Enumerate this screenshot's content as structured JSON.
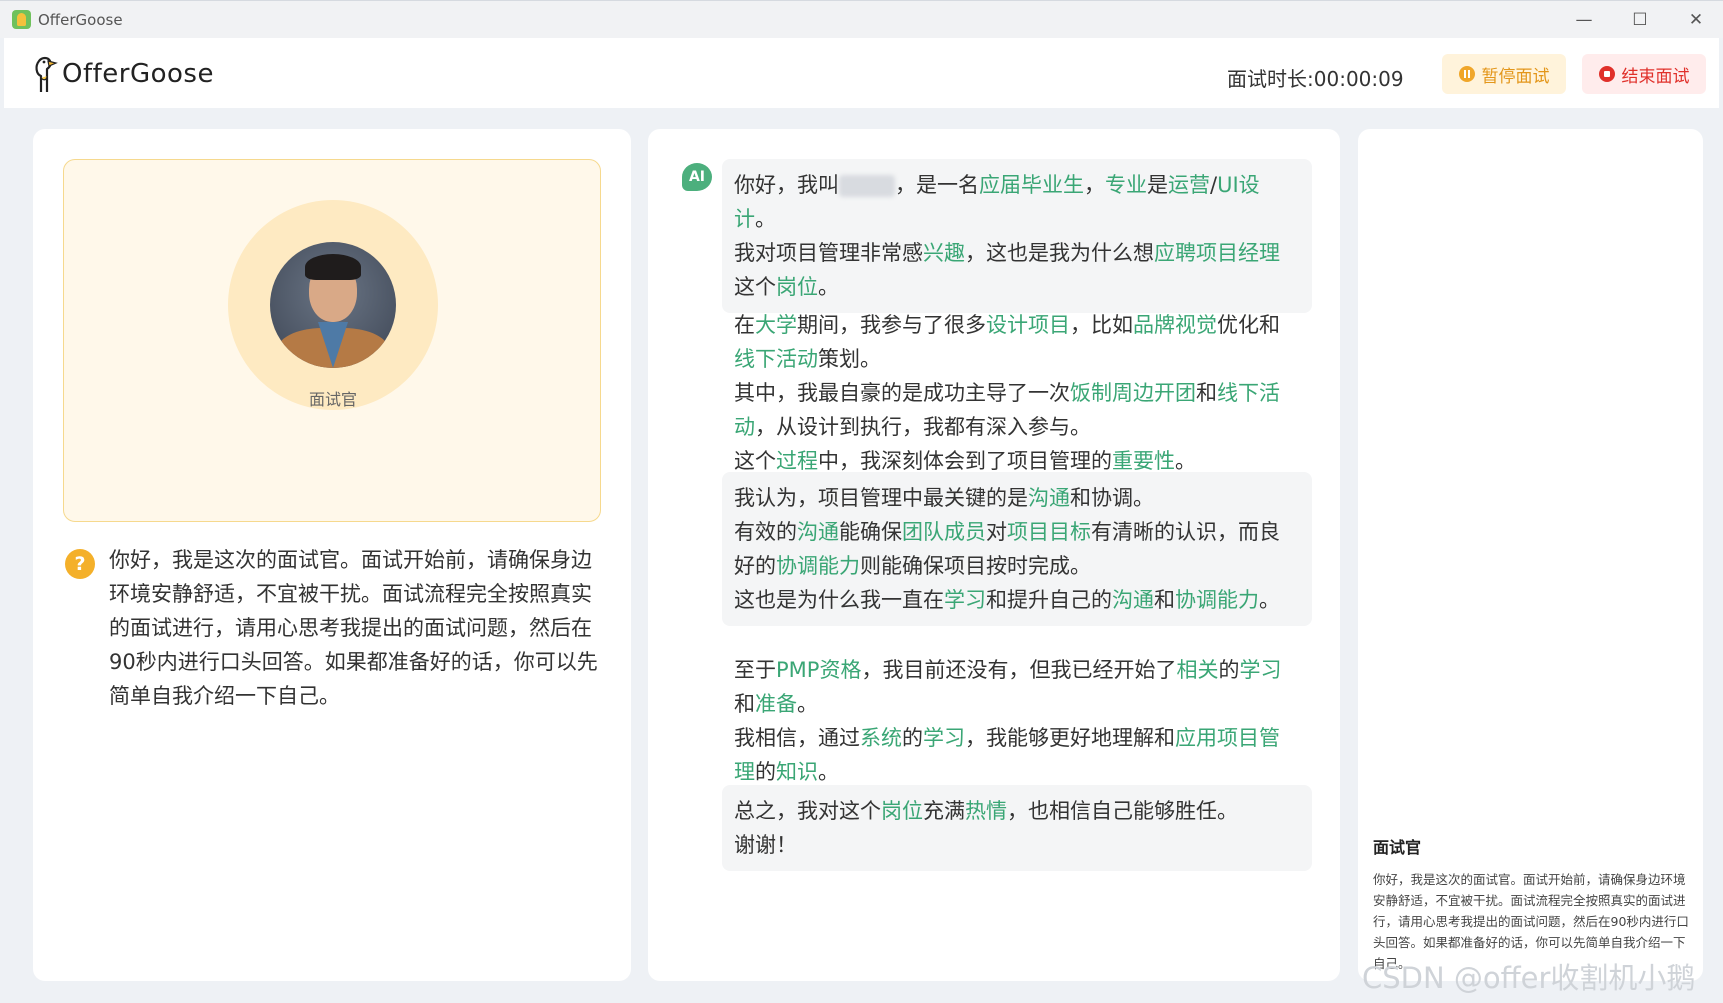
{
  "window": {
    "title": "OfferGoose",
    "controls": [
      "—",
      "☐",
      "✕"
    ]
  },
  "header": {
    "logo_text": "OfferGoose",
    "timer_label": "面试时长:",
    "timer_value": "00:00:09",
    "pause_label": "暂停面试",
    "end_label": "结束面试"
  },
  "interviewer_card": {
    "label": "面试官",
    "question": "你好，我是这次的面试官。面试开始前，请确保身边环境安静舒适，不宜被干扰。面试流程完全按照真实的面试进行，请用心思考我提出的面试问题，然后在90秒内进行口头回答。如果都准备好的话，你可以先简单自我介绍一下自己。"
  },
  "chat": {
    "badge": "AI",
    "messages": [
      {
        "segments": [
          {
            "t": "你好，我叫"
          },
          {
            "t": "",
            "blur": true
          },
          {
            "t": "，是一名"
          },
          {
            "t": "应届毕业生",
            "h": true
          },
          {
            "t": "，"
          },
          {
            "t": "专业",
            "h": true
          },
          {
            "t": "是"
          },
          {
            "t": "运营",
            "h": true
          },
          {
            "t": "/"
          },
          {
            "t": "UI设计",
            "h": true
          },
          {
            "t": "。"
          },
          {
            "br": true
          },
          {
            "t": "我对项目管理非常感"
          },
          {
            "t": "兴趣",
            "h": true
          },
          {
            "t": "，这也是我为什么想"
          },
          {
            "t": "应聘项目经理",
            "h": true
          },
          {
            "t": "这个"
          },
          {
            "t": "岗位",
            "h": true
          },
          {
            "t": "。"
          }
        ]
      },
      {
        "segments": [
          {
            "t": "在"
          },
          {
            "t": "大学",
            "h": true
          },
          {
            "t": "期间，我参与了很多"
          },
          {
            "t": "设计项目",
            "h": true
          },
          {
            "t": "，比如"
          },
          {
            "t": "品牌视觉",
            "h": true
          },
          {
            "t": "优化和"
          },
          {
            "t": "线下活动",
            "h": true
          },
          {
            "t": "策划。"
          },
          {
            "br": true
          },
          {
            "t": "其中，我最自豪的是成功主导了一次"
          },
          {
            "t": "饭制周边开团",
            "h": true
          },
          {
            "t": "和"
          },
          {
            "t": "线下活动",
            "h": true
          },
          {
            "t": "，从设计到执行，我都有深入参与。"
          },
          {
            "br": true
          },
          {
            "t": "这个"
          },
          {
            "t": "过程",
            "h": true
          },
          {
            "t": "中，我深刻体会到了项目管理的"
          },
          {
            "t": "重要性",
            "h": true
          },
          {
            "t": "。"
          }
        ]
      },
      {
        "segments": [
          {
            "t": "我认为，项目管理中最关键的是"
          },
          {
            "t": "沟通",
            "h": true
          },
          {
            "t": "和协调。"
          },
          {
            "br": true
          },
          {
            "t": "有效的"
          },
          {
            "t": "沟通",
            "h": true
          },
          {
            "t": "能确保"
          },
          {
            "t": "团队成员",
            "h": true
          },
          {
            "t": "对"
          },
          {
            "t": "项目目标",
            "h": true
          },
          {
            "t": "有清晰的认识，而良好的"
          },
          {
            "t": "协调能力",
            "h": true
          },
          {
            "t": "则能确保项目按时完成。"
          },
          {
            "br": true
          },
          {
            "t": "这也是为什么我一直在"
          },
          {
            "t": "学习",
            "h": true
          },
          {
            "t": "和提升自己的"
          },
          {
            "t": "沟通",
            "h": true
          },
          {
            "t": "和"
          },
          {
            "t": "协调能力",
            "h": true
          },
          {
            "t": "。"
          }
        ]
      },
      {
        "segments": [
          {
            "t": "至于"
          },
          {
            "t": "PMP资格",
            "h": true
          },
          {
            "t": "，我目前还没有，但我已经开始了"
          },
          {
            "t": "相关",
            "h": true
          },
          {
            "t": "的"
          },
          {
            "t": "学习",
            "h": true
          },
          {
            "t": "和"
          },
          {
            "t": "准备",
            "h": true
          },
          {
            "t": "。"
          },
          {
            "br": true
          },
          {
            "t": "我相信，通过"
          },
          {
            "t": "系统",
            "h": true
          },
          {
            "t": "的"
          },
          {
            "t": "学习",
            "h": true
          },
          {
            "t": "，我能够更好地理解和"
          },
          {
            "t": "应用项目管理",
            "h": true
          },
          {
            "t": "的"
          },
          {
            "t": "知识",
            "h": true
          },
          {
            "t": "。"
          }
        ]
      },
      {
        "segments": [
          {
            "t": "总之，我对这个"
          },
          {
            "t": "岗位",
            "h": true
          },
          {
            "t": "充满"
          },
          {
            "t": "热情",
            "h": true
          },
          {
            "t": "，也相信自己能够胜任。"
          },
          {
            "br": true
          },
          {
            "t": "谢谢！"
          }
        ]
      }
    ]
  },
  "side": {
    "title": "面试官",
    "text": "你好，我是这次的面试官。面试开始前，请确保身边环境安静舒适，不宜被干扰。面试流程完全按照真实的面试进行，请用心思考我提出的面试问题，然后在90秒内进行口头回答。如果都准备好的话，你可以先简单自我介绍一下自己。"
  },
  "watermark": "CSDN @offer收割机小鹅",
  "colors": {
    "highlight": "#3aa675",
    "pause": "#e3961a",
    "end": "#e0302a",
    "card_border": "#f6d98e"
  }
}
